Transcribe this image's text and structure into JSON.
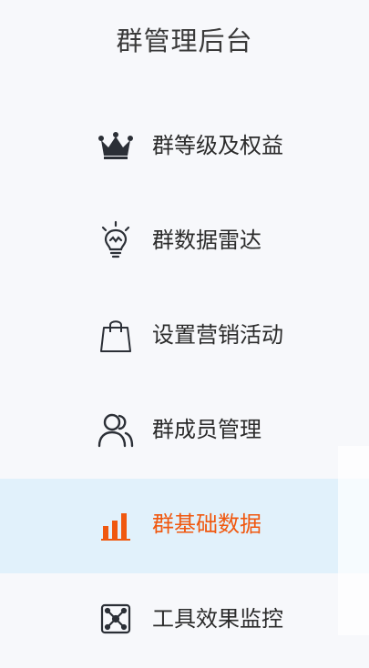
{
  "sidebar": {
    "title": "群管理后台",
    "accent_color": "#f0580f",
    "items": [
      {
        "label": "群等级及权益",
        "icon": "crown-icon",
        "active": false
      },
      {
        "label": "群数据雷达",
        "icon": "lightbulb-icon",
        "active": false
      },
      {
        "label": "设置营销活动",
        "icon": "shopping-bag-icon",
        "active": false
      },
      {
        "label": "群成员管理",
        "icon": "members-icon",
        "active": false
      },
      {
        "label": "群基础数据",
        "icon": "bar-chart-icon",
        "active": true
      },
      {
        "label": "工具效果监控",
        "icon": "network-icon",
        "active": false
      }
    ]
  }
}
